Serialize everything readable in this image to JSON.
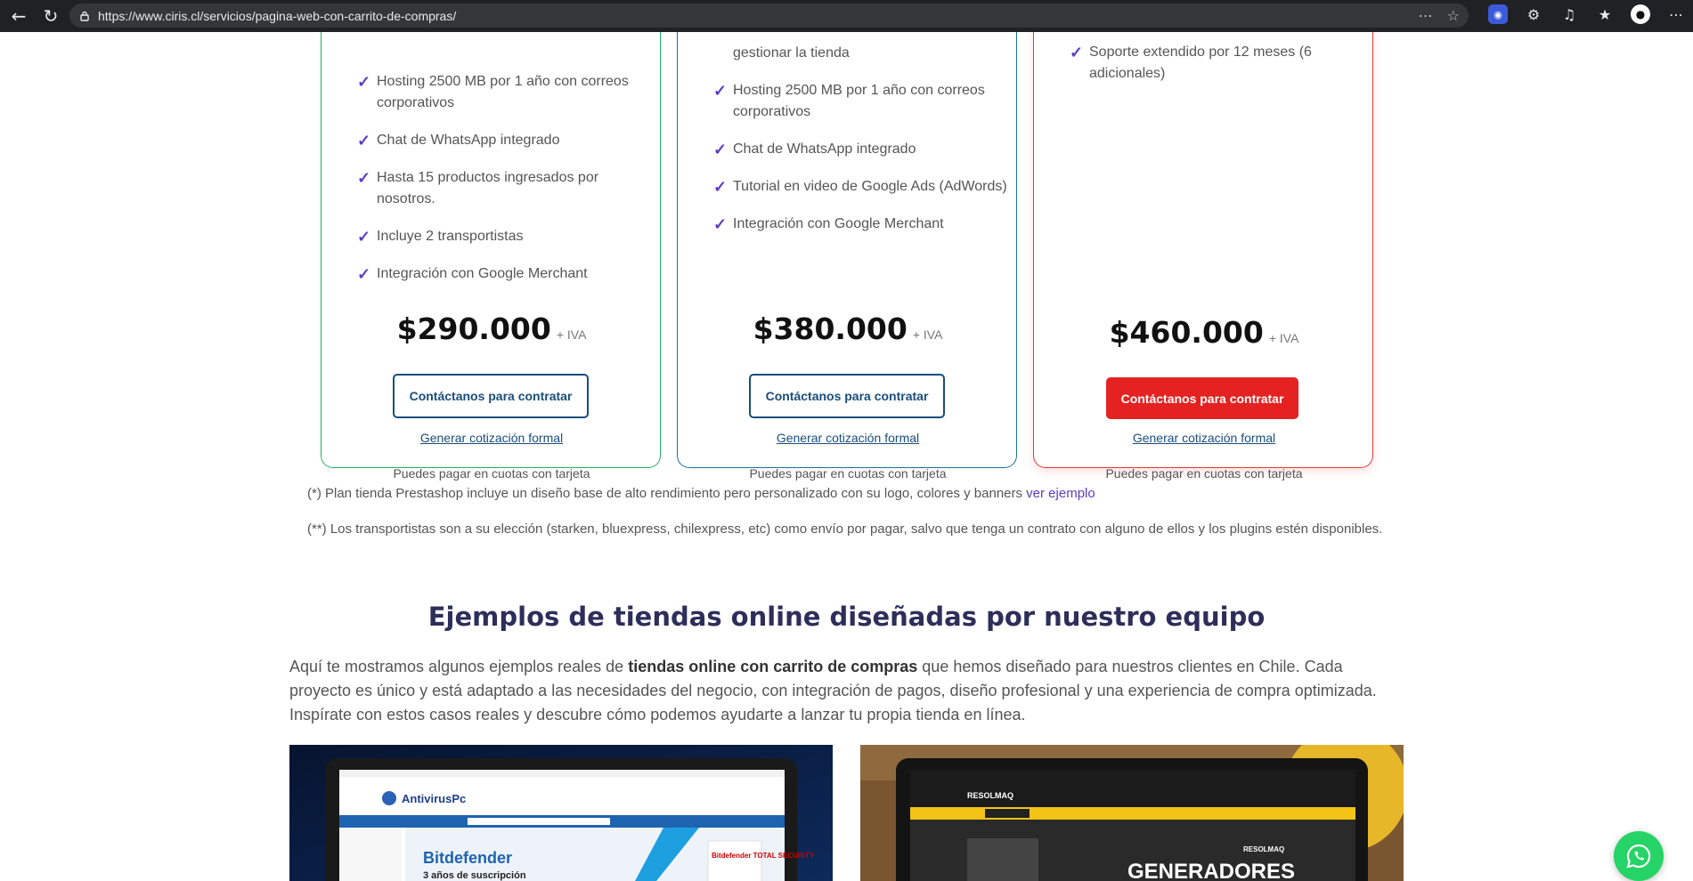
{
  "browser": {
    "url": "https://www.ciris.cl/servicios/pagina-web-con-carrito-de-compras/"
  },
  "plans": [
    {
      "features": [
        "Hosting 2500 MB por 1 año con correos corporativos",
        "Chat de WhatsApp integrado",
        "Hasta 15 productos ingresados por nosotros.",
        "Incluye 2 transportistas",
        "Integración con Google Merchant"
      ],
      "price": "$290.000",
      "iva": "+ IVA",
      "cta": "Contáctanos para contratar",
      "quote_link": "Generar cotización formal",
      "note": "Puedes pagar en cuotas con tarjeta",
      "border_color": "#27ae60"
    },
    {
      "features": [
        "gestionar la tienda",
        "Hosting 2500 MB por 1 año con correos corporativos",
        "Chat de WhatsApp integrado",
        "Tutorial en video de Google Ads (AdWords)",
        "Integración con Google Merchant"
      ],
      "price": "$380.000",
      "iva": "+ IVA",
      "cta": "Contáctanos para contratar",
      "quote_link": "Generar cotización formal",
      "note": "Puedes pagar en cuotas con tarjeta",
      "border_color": "#1b6ea0"
    },
    {
      "features": [
        "Soporte extendido por 12 meses (6 adicionales)"
      ],
      "price": "$460.000",
      "iva": "+ IVA",
      "cta": "Contáctanos para contratar",
      "quote_link": "Generar cotización formal",
      "note": "Puedes pagar en cuotas con tarjeta",
      "border_color": "#e53935"
    }
  ],
  "footnotes": {
    "one": "(*) Plan tienda Prestashop incluye un diseño base de alto rendimiento pero personalizado con su logo, colores y banners",
    "one_link": "ver ejemplo",
    "two": "(**) Los transportistas son a su elección (starken, bluexpress, chilexpress, etc) como envío por pagar, salvo que tenga un contrato con alguno de ellos y los plugins estén disponibles."
  },
  "examples_section": {
    "title": "Ejemplos de tiendas online diseñadas por nuestro equipo",
    "intro_before": "Aquí te mostramos algunos ejemplos reales de ",
    "intro_bold": "tiendas online con carrito de compras",
    "intro_after": " que hemos diseñado para nuestros clientes en Chile. Cada proyecto es único y está adaptado a las necesidades del negocio, con integración de pagos, diseño profesional y una experiencia de compra optimizada. Inspírate con estos casos reales y descubre cómo podemos ayudarte a lanzar tu propia tienda en línea."
  },
  "examples": [
    {
      "logo": "AntivirusPc",
      "banner_title": "Bitdefender",
      "banner_sub": "3 años de suscripción",
      "product": "Bitdefender TOTAL SECURITY"
    },
    {
      "logo": "RESOLMAQ",
      "brand": "RESOLMAQ",
      "headline": "GENERADORES"
    }
  ],
  "colors": {
    "accent_purple": "#5b3cc4",
    "link_blue": "#1a4d7a",
    "cta_red": "#e52222",
    "title_navy": "#2e2e5a",
    "whatsapp_green": "#25d366"
  },
  "icons": {
    "whatsapp": "whatsapp-icon",
    "check": "check-icon"
  }
}
